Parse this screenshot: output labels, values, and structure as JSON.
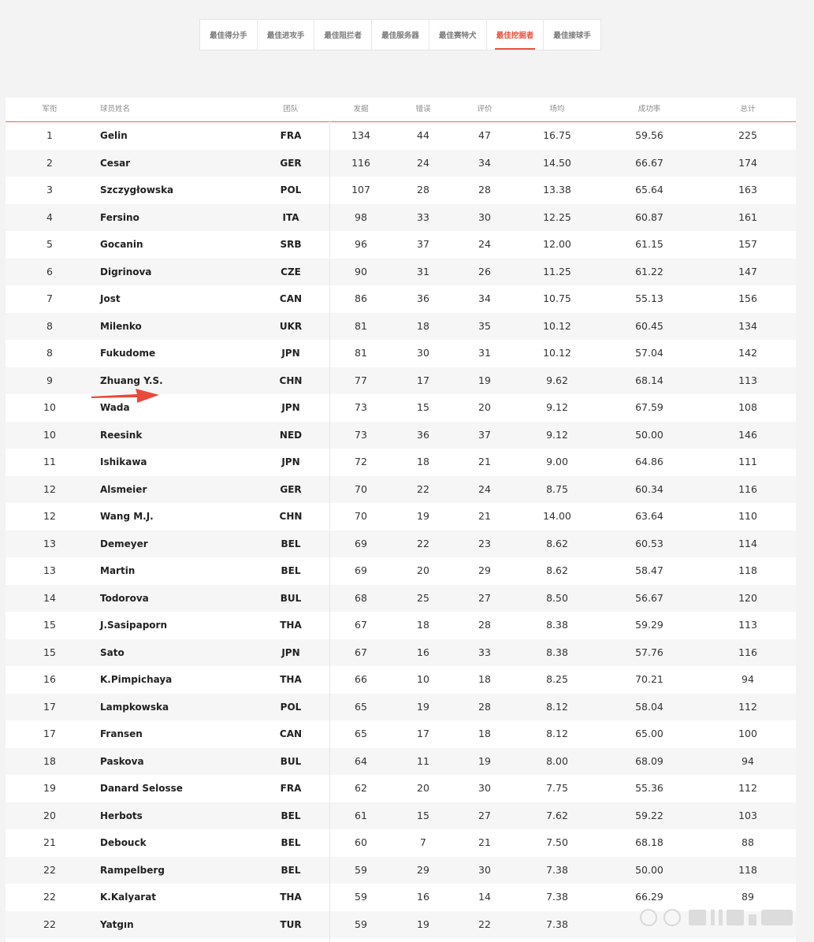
{
  "tabs": [
    {
      "label": "最佳得分手",
      "active": false
    },
    {
      "label": "最佳进攻手",
      "active": false
    },
    {
      "label": "最佳阻拦者",
      "active": false
    },
    {
      "label": "最佳服务器",
      "active": false
    },
    {
      "label": "最佳赛特犬",
      "active": false
    },
    {
      "label": "最佳挖掘者",
      "active": true
    },
    {
      "label": "最佳接球手",
      "active": false
    }
  ],
  "colors": {
    "accent": "#e8533f",
    "arrow": "#ea4a3a"
  },
  "table": {
    "headers": {
      "rank": "军衔",
      "name": "球员姓名",
      "team": "团队",
      "digs": "发掘",
      "errors": "错误",
      "reception": "评价",
      "avg": "场均",
      "success": "成功率",
      "total": "总计"
    },
    "rows": [
      {
        "rank": "1",
        "name": "Gelin",
        "team": "FRA",
        "digs": "134",
        "errors": "44",
        "reception": "47",
        "avg": "16.75",
        "success": "59.56",
        "total": "225"
      },
      {
        "rank": "2",
        "name": "Cesar",
        "team": "GER",
        "digs": "116",
        "errors": "24",
        "reception": "34",
        "avg": "14.50",
        "success": "66.67",
        "total": "174"
      },
      {
        "rank": "3",
        "name": "Szczygłowska",
        "team": "POL",
        "digs": "107",
        "errors": "28",
        "reception": "28",
        "avg": "13.38",
        "success": "65.64",
        "total": "163"
      },
      {
        "rank": "4",
        "name": "Fersino",
        "team": "ITA",
        "digs": "98",
        "errors": "33",
        "reception": "30",
        "avg": "12.25",
        "success": "60.87",
        "total": "161"
      },
      {
        "rank": "5",
        "name": "Gocanin",
        "team": "SRB",
        "digs": "96",
        "errors": "37",
        "reception": "24",
        "avg": "12.00",
        "success": "61.15",
        "total": "157"
      },
      {
        "rank": "6",
        "name": "Digrinova",
        "team": "CZE",
        "digs": "90",
        "errors": "31",
        "reception": "26",
        "avg": "11.25",
        "success": "61.22",
        "total": "147"
      },
      {
        "rank": "7",
        "name": "Jost",
        "team": "CAN",
        "digs": "86",
        "errors": "36",
        "reception": "34",
        "avg": "10.75",
        "success": "55.13",
        "total": "156"
      },
      {
        "rank": "8",
        "name": "Milenko",
        "team": "UKR",
        "digs": "81",
        "errors": "18",
        "reception": "35",
        "avg": "10.12",
        "success": "60.45",
        "total": "134"
      },
      {
        "rank": "8",
        "name": "Fukudome",
        "team": "JPN",
        "digs": "81",
        "errors": "30",
        "reception": "31",
        "avg": "10.12",
        "success": "57.04",
        "total": "142"
      },
      {
        "rank": "9",
        "name": "Zhuang Y.S.",
        "team": "CHN",
        "digs": "77",
        "errors": "17",
        "reception": "19",
        "avg": "9.62",
        "success": "68.14",
        "total": "113"
      },
      {
        "rank": "10",
        "name": "Wada",
        "team": "JPN",
        "digs": "73",
        "errors": "15",
        "reception": "20",
        "avg": "9.12",
        "success": "67.59",
        "total": "108"
      },
      {
        "rank": "10",
        "name": "Reesink",
        "team": "NED",
        "digs": "73",
        "errors": "36",
        "reception": "37",
        "avg": "9.12",
        "success": "50.00",
        "total": "146"
      },
      {
        "rank": "11",
        "name": "Ishikawa",
        "team": "JPN",
        "digs": "72",
        "errors": "18",
        "reception": "21",
        "avg": "9.00",
        "success": "64.86",
        "total": "111"
      },
      {
        "rank": "12",
        "name": "Alsmeier",
        "team": "GER",
        "digs": "70",
        "errors": "22",
        "reception": "24",
        "avg": "8.75",
        "success": "60.34",
        "total": "116"
      },
      {
        "rank": "12",
        "name": "Wang M.J.",
        "team": "CHN",
        "digs": "70",
        "errors": "19",
        "reception": "21",
        "avg": "14.00",
        "success": "63.64",
        "total": "110"
      },
      {
        "rank": "13",
        "name": "Demeyer",
        "team": "BEL",
        "digs": "69",
        "errors": "22",
        "reception": "23",
        "avg": "8.62",
        "success": "60.53",
        "total": "114"
      },
      {
        "rank": "13",
        "name": "Martin",
        "team": "BEL",
        "digs": "69",
        "errors": "20",
        "reception": "29",
        "avg": "8.62",
        "success": "58.47",
        "total": "118"
      },
      {
        "rank": "14",
        "name": "Todorova",
        "team": "BUL",
        "digs": "68",
        "errors": "25",
        "reception": "27",
        "avg": "8.50",
        "success": "56.67",
        "total": "120"
      },
      {
        "rank": "15",
        "name": "J.Sasipaporn",
        "team": "THA",
        "digs": "67",
        "errors": "18",
        "reception": "28",
        "avg": "8.38",
        "success": "59.29",
        "total": "113"
      },
      {
        "rank": "15",
        "name": "Sato",
        "team": "JPN",
        "digs": "67",
        "errors": "16",
        "reception": "33",
        "avg": "8.38",
        "success": "57.76",
        "total": "116"
      },
      {
        "rank": "16",
        "name": "K.Pimpichaya",
        "team": "THA",
        "digs": "66",
        "errors": "10",
        "reception": "18",
        "avg": "8.25",
        "success": "70.21",
        "total": "94"
      },
      {
        "rank": "17",
        "name": "Lampkowska",
        "team": "POL",
        "digs": "65",
        "errors": "19",
        "reception": "28",
        "avg": "8.12",
        "success": "58.04",
        "total": "112"
      },
      {
        "rank": "17",
        "name": "Fransen",
        "team": "CAN",
        "digs": "65",
        "errors": "17",
        "reception": "18",
        "avg": "8.12",
        "success": "65.00",
        "total": "100"
      },
      {
        "rank": "18",
        "name": "Paskova",
        "team": "BUL",
        "digs": "64",
        "errors": "11",
        "reception": "19",
        "avg": "8.00",
        "success": "68.09",
        "total": "94"
      },
      {
        "rank": "19",
        "name": "Danard Selosse",
        "team": "FRA",
        "digs": "62",
        "errors": "20",
        "reception": "30",
        "avg": "7.75",
        "success": "55.36",
        "total": "112"
      },
      {
        "rank": "20",
        "name": "Herbots",
        "team": "BEL",
        "digs": "61",
        "errors": "15",
        "reception": "27",
        "avg": "7.62",
        "success": "59.22",
        "total": "103"
      },
      {
        "rank": "21",
        "name": "Debouck",
        "team": "BEL",
        "digs": "60",
        "errors": "7",
        "reception": "21",
        "avg": "7.50",
        "success": "68.18",
        "total": "88"
      },
      {
        "rank": "22",
        "name": "Rampelberg",
        "team": "BEL",
        "digs": "59",
        "errors": "29",
        "reception": "30",
        "avg": "7.38",
        "success": "50.00",
        "total": "118"
      },
      {
        "rank": "22",
        "name": "K.Kalyarat",
        "team": "THA",
        "digs": "59",
        "errors": "16",
        "reception": "14",
        "avg": "7.38",
        "success": "66.29",
        "total": "89"
      },
      {
        "rank": "22",
        "name": "Yatgın",
        "team": "TUR",
        "digs": "59",
        "errors": "19",
        "reception": "22",
        "avg": "7.38",
        "success": "",
        "total": ""
      }
    ]
  }
}
